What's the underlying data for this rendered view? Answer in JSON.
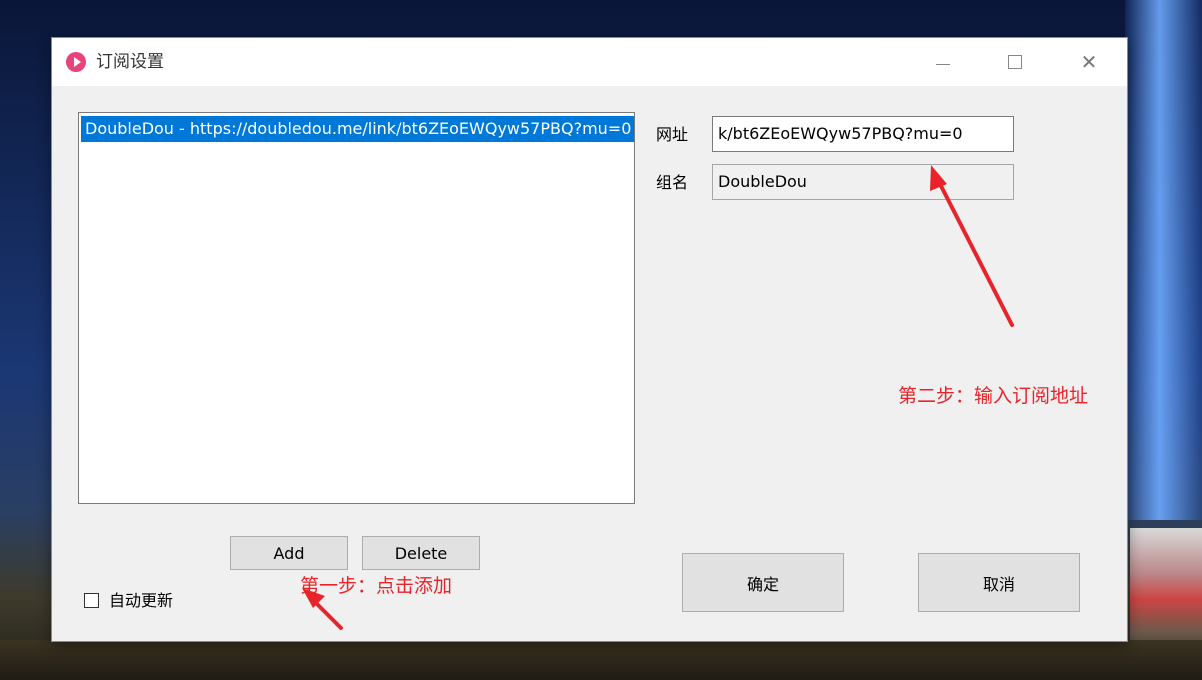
{
  "dialog": {
    "title": "订阅设置",
    "window_controls": {
      "minimize_icon": "minimize-icon",
      "maximize_icon": "maximize-icon",
      "close_icon": "close-icon",
      "close_glyph": "✕"
    }
  },
  "subscription_list": {
    "items": [
      {
        "label": "DoubleDou - https://doubledou.me/link/bt6ZEoEWQyw57PBQ?mu=0",
        "selected": true
      }
    ]
  },
  "buttons": {
    "add": "Add",
    "delete": "Delete",
    "ok": "确定",
    "cancel": "取消"
  },
  "auto_update": {
    "label": "自动更新",
    "checked": false
  },
  "fields": {
    "url_label": "网址",
    "url_value": "k/bt6ZEoEWQyw57PBQ?mu=0",
    "group_label": "组名",
    "group_value": "DoubleDou"
  },
  "annotations": {
    "step1": "第一步：点击添加",
    "step2": "第二步：输入订阅地址",
    "color": "#e8242a"
  },
  "colors": {
    "selection": "#0078d7",
    "dialog_bg": "#f0f0f0",
    "app_icon": "#e8437a"
  }
}
